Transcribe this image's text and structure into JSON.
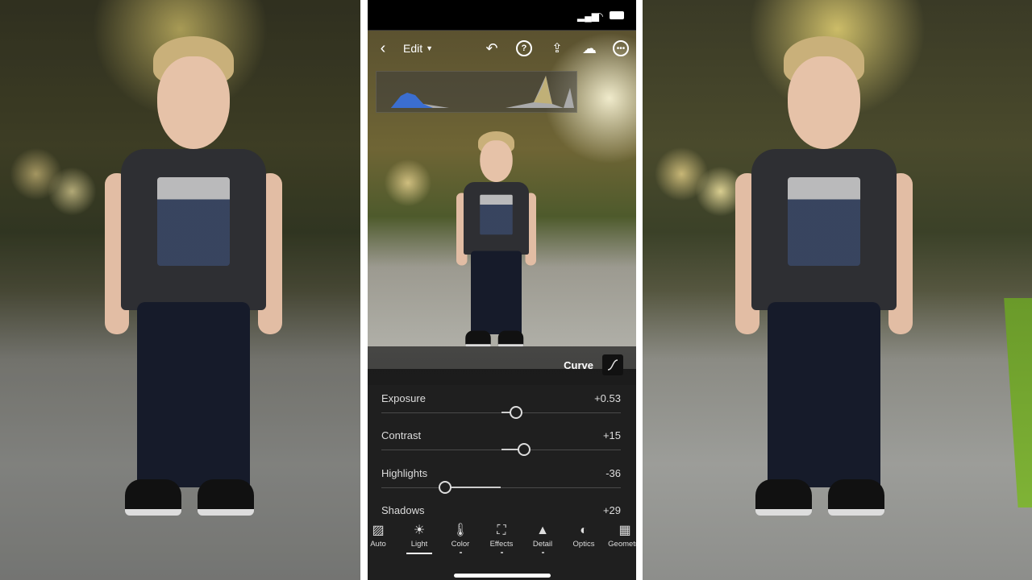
{
  "comparison": {
    "before_photo": "original",
    "after_photo": "edited"
  },
  "app": {
    "status_bar": {
      "icons": [
        "signal-icon",
        "wifi-icon",
        "battery-icon"
      ]
    },
    "toolbar": {
      "back_icon": "chevron-left-icon",
      "mode_label": "Edit",
      "icons": [
        "undo-icon",
        "help-icon",
        "share-icon",
        "cloud-add-icon",
        "more-icon"
      ]
    },
    "panel": {
      "curve_label": "Curve",
      "sliders": [
        {
          "label": "Exposure",
          "value": "+0.53",
          "numeric": 0.53,
          "min": -5,
          "max": 5
        },
        {
          "label": "Contrast",
          "value": "+15",
          "numeric": 15,
          "min": -100,
          "max": 100
        },
        {
          "label": "Highlights",
          "value": "-36",
          "numeric": -36,
          "min": -100,
          "max": 100
        },
        {
          "label": "Shadows",
          "value": "+29",
          "numeric": 29,
          "min": -100,
          "max": 100
        }
      ]
    },
    "tabs": [
      {
        "label": "Auto",
        "icon": "auto-icon",
        "glyph": "▨"
      },
      {
        "label": "Light",
        "icon": "sun-icon",
        "glyph": "☀",
        "active": true
      },
      {
        "label": "Color",
        "icon": "thermometer-icon",
        "glyph": "🌡"
      },
      {
        "label": "Effects",
        "icon": "effects-icon",
        "glyph": "⛶"
      },
      {
        "label": "Detail",
        "icon": "triangle-icon",
        "glyph": "▲"
      },
      {
        "label": "Optics",
        "icon": "lens-icon",
        "glyph": "◐"
      },
      {
        "label": "Geometry",
        "icon": "grid-icon",
        "glyph": "▦"
      }
    ]
  },
  "colors": {
    "panel_bg": "#1f1f1f",
    "grass": "#7fb336"
  }
}
